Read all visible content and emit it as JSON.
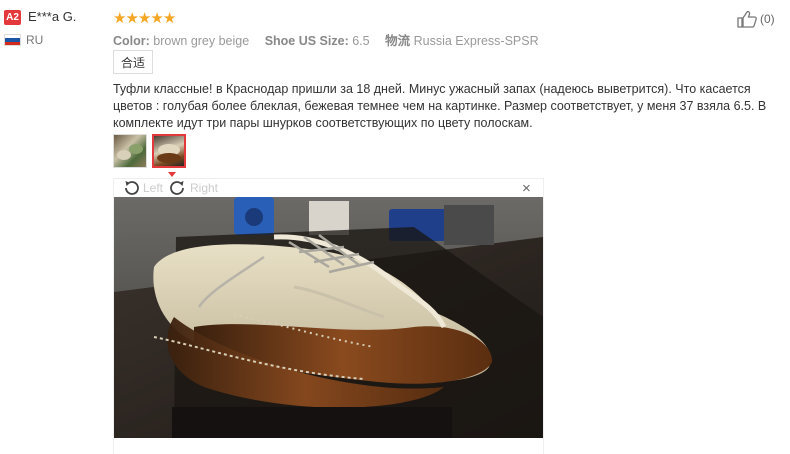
{
  "reviewer": {
    "level_badge": "A2",
    "name": "E***a G.",
    "country": "RU"
  },
  "rating": {
    "stars": 5
  },
  "like": {
    "count": "(0)"
  },
  "attributes": [
    {
      "key": "Color:",
      "value": "brown grey beige"
    },
    {
      "key": "Shoe US Size:",
      "value": "6.5"
    },
    {
      "key": "物流",
      "value": "Russia Express-SPSR"
    }
  ],
  "translate_button": "合适",
  "review_text": "Туфли классные! в Краснодар пришли за 18 дней. Минус ужасный запах (надеюсь выветрится). Что касается цветов : голубая более блеклая, бежевая темнее чем на картинке. Размер соответствует, у меня 37 взяла 6.5. В комплекте идут три пары шнурков соответствующих по цвету полоскам.",
  "viewer": {
    "rotate_left": "Left",
    "rotate_right": "Right",
    "close": "×"
  },
  "colors": {
    "badge": "#e4393c",
    "stars": "#f5a623",
    "selected_thumb": "#e4393c"
  }
}
